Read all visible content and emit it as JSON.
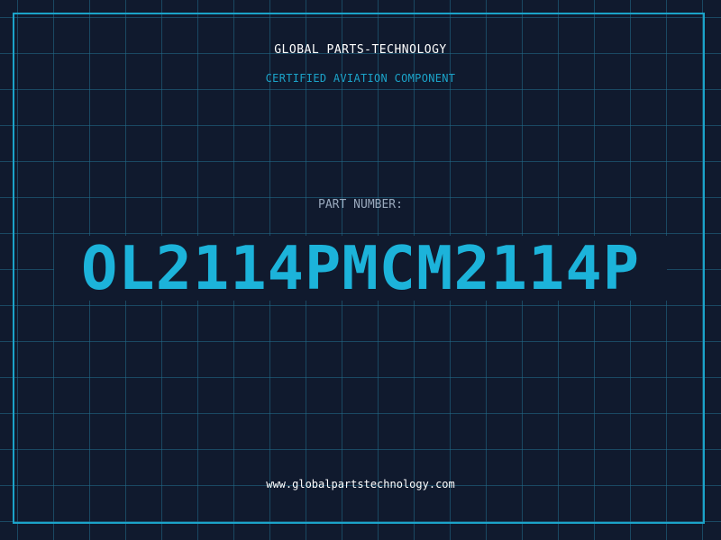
{
  "header": {
    "company": "GLOBAL PARTS-TECHNOLOGY",
    "tagline": "CERTIFIED AVIATION COMPONENT"
  },
  "part": {
    "label": "PART NUMBER:",
    "number": "OL2114PMCM2114P"
  },
  "footer": {
    "website": "www.globalpartstechnology.com"
  },
  "colors": {
    "background": "#101a2e",
    "accent": "#1ba3c9",
    "grid": "#226e8c",
    "part_number": "#1cb3da"
  }
}
